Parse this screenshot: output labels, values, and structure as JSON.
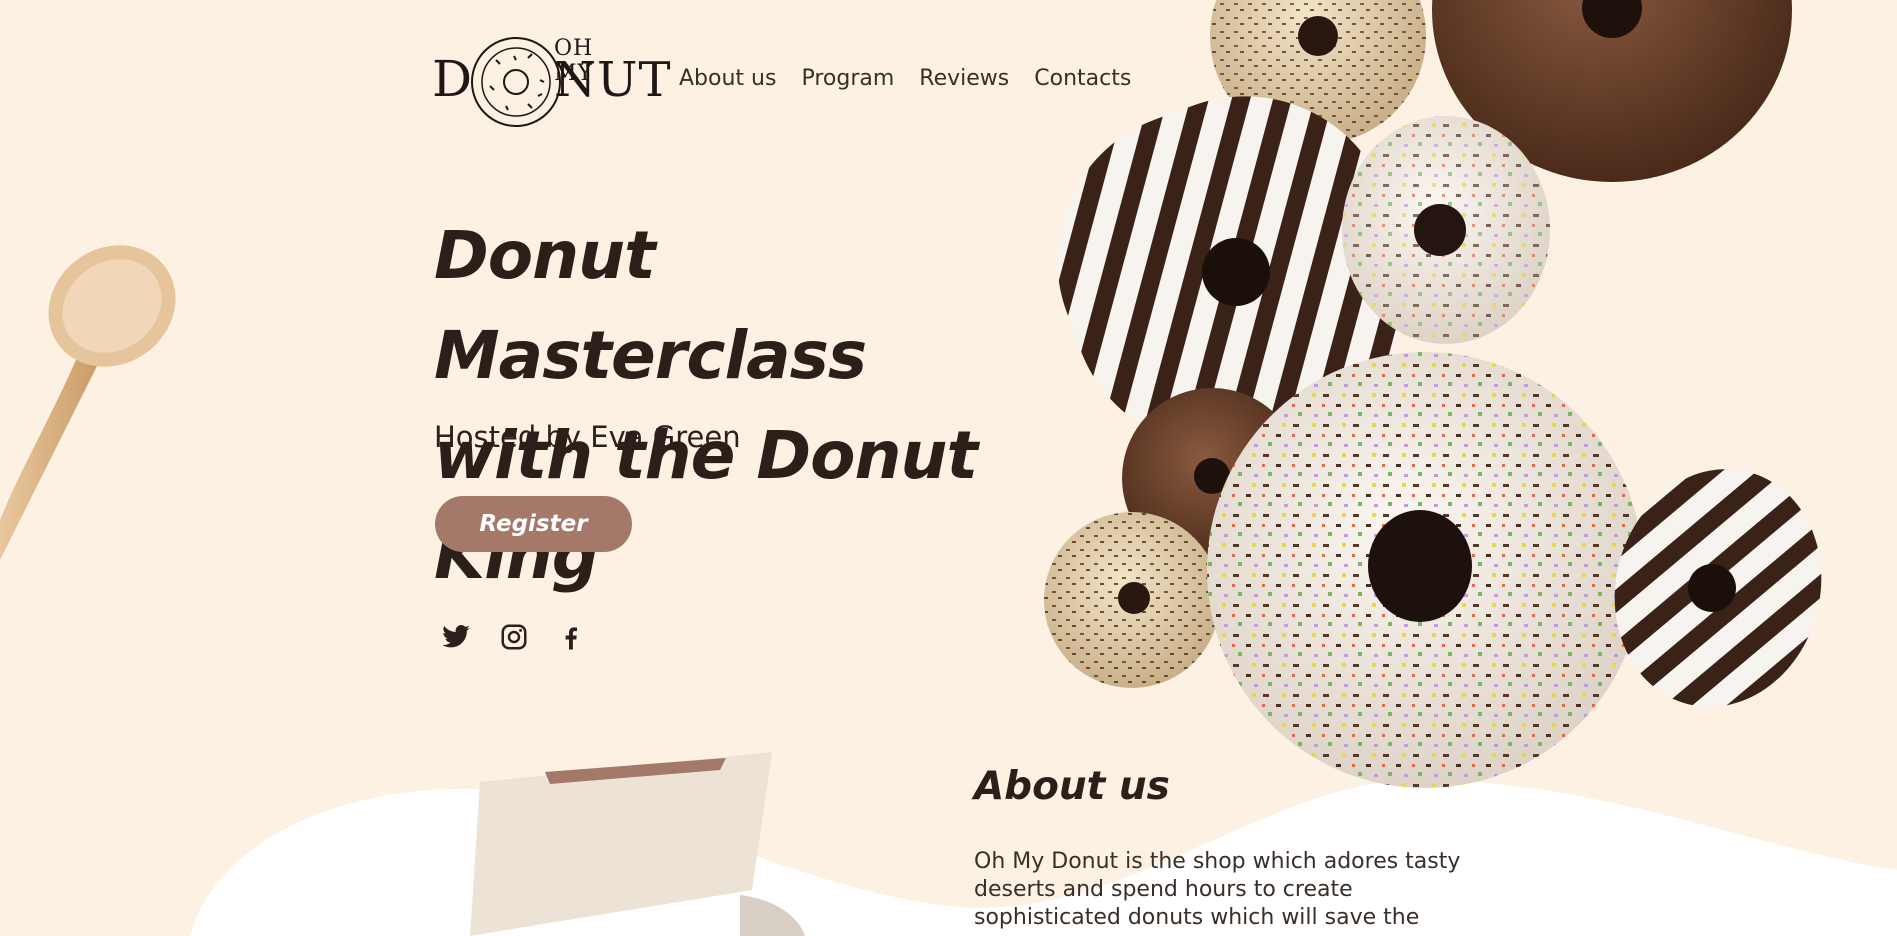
{
  "brand": {
    "logo_top": "OH MY",
    "logo_d": "D",
    "logo_nut": "NUT",
    "logo_icon": "donut-ring-icon"
  },
  "nav": {
    "items": [
      {
        "label": "About us"
      },
      {
        "label": "Program"
      },
      {
        "label": "Reviews"
      },
      {
        "label": "Contacts"
      }
    ]
  },
  "hero": {
    "title_line1": "Donut Masterclass",
    "title_line2": "with the Donut King",
    "subtitle": "Hosted by Eva Green",
    "register_label": "Register"
  },
  "social": [
    {
      "icon": "twitter-icon"
    },
    {
      "icon": "instagram-icon"
    },
    {
      "icon": "facebook-icon"
    }
  ],
  "about": {
    "title": "About us",
    "text": "Oh My Donut is the shop which adores tasty deserts and spend hours to create sophisticated donuts which will save the"
  },
  "colors": {
    "background": "#fdf1e4",
    "accent": "#a4796a",
    "text": "#2b211c"
  }
}
